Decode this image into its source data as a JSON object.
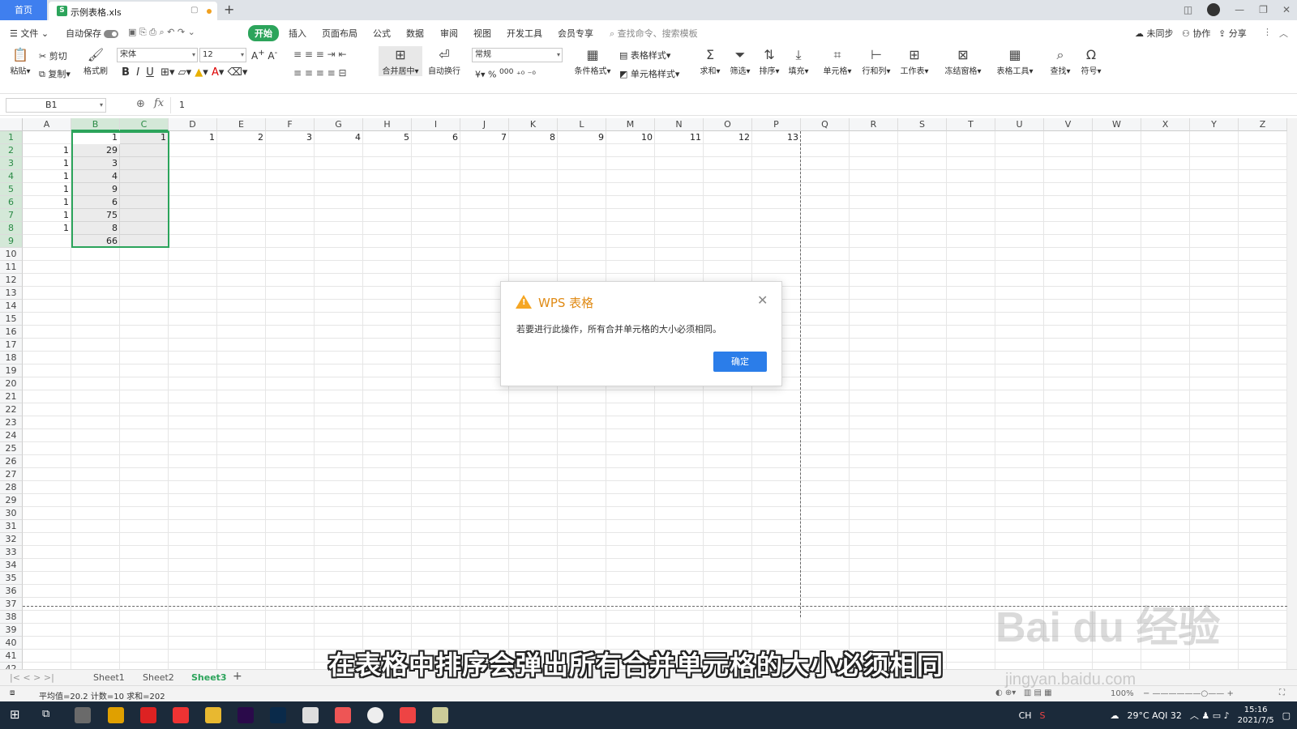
{
  "tabs": {
    "home": "首页",
    "file": "示例表格.xls"
  },
  "menu": {
    "file": "文件",
    "autosave": "自动保存",
    "items": [
      "开始",
      "插入",
      "页面布局",
      "公式",
      "数据",
      "审阅",
      "视图",
      "开发工具",
      "会员专享"
    ],
    "search_placeholder": "查找命令、搜索模板",
    "sync": "未同步",
    "collab": "协作",
    "share": "分享"
  },
  "ribbon": {
    "paste": "粘贴",
    "cut": "剪切",
    "copy": "复制",
    "format_painter": "格式刷",
    "font": "宋体",
    "size": "12",
    "merge": "合并居中",
    "wrap": "自动换行",
    "numfmt": "常规",
    "table_style": "表格样式",
    "cond_fmt": "条件格式",
    "cell_style": "单元格样式",
    "sum": "求和",
    "filter": "筛选",
    "sort": "排序",
    "fill": "填充",
    "cell": "单元格",
    "rowcol": "行和列",
    "sheet": "工作表",
    "freeze": "冻结窗格",
    "tools": "表格工具",
    "find": "查找",
    "symbol": "符号"
  },
  "formula_bar": {
    "cell_ref": "B1",
    "fx": "fx",
    "value": "1"
  },
  "columns": [
    "A",
    "B",
    "C",
    "D",
    "E",
    "F",
    "G",
    "H",
    "I",
    "J",
    "K",
    "L",
    "M",
    "N",
    "O",
    "P",
    "Q",
    "R",
    "S",
    "T",
    "U",
    "V",
    "W",
    "X",
    "Y",
    "Z"
  ],
  "rows": [
    "1",
    "2",
    "3",
    "4",
    "5",
    "6",
    "7",
    "8",
    "9",
    "10",
    "11",
    "12",
    "13",
    "14",
    "15",
    "16",
    "17",
    "18",
    "19",
    "20",
    "21",
    "22",
    "23",
    "24",
    "25",
    "26",
    "27",
    "28",
    "29",
    "30",
    "31",
    "32",
    "33",
    "34",
    "35",
    "36",
    "37",
    "38",
    "39",
    "40",
    "41",
    "42"
  ],
  "cells": {
    "row1": {
      "B": "1",
      "C": "1",
      "D": "1",
      "E": "2",
      "F": "3",
      "G": "4",
      "H": "5",
      "I": "6",
      "J": "7",
      "K": "8",
      "L": "9",
      "M": "10",
      "N": "11",
      "O": "12",
      "P": "13"
    },
    "colA": [
      "1",
      "1",
      "1",
      "1",
      "1",
      "1",
      "1"
    ],
    "colB": [
      "29",
      "3",
      "4",
      "9",
      "6",
      "75",
      "8",
      "66"
    ]
  },
  "dialog": {
    "title": "WPS 表格",
    "message": "若要进行此操作，所有合并单元格的大小必须相同。",
    "ok": "确定"
  },
  "sheets": [
    "Sheet1",
    "Sheet2",
    "Sheet3"
  ],
  "active_sheet": "Sheet3",
  "status": {
    "summary": "平均值=20.2  计数=10  求和=202",
    "zoom": "100%"
  },
  "subtitle": "在表格中排序会弹出所有合并单元格的大小必须相同",
  "watermark": {
    "brand": "Bai du 经验",
    "url": "jingyan.baidu.com"
  },
  "taskbar": {
    "weather": "29°C  AQI 32",
    "lang": "CH",
    "time": "15:16",
    "date": "2021/7/5"
  },
  "colors": {
    "accent": "#2ca45b",
    "primary_button": "#2b7de9",
    "warning": "#f5a623"
  }
}
